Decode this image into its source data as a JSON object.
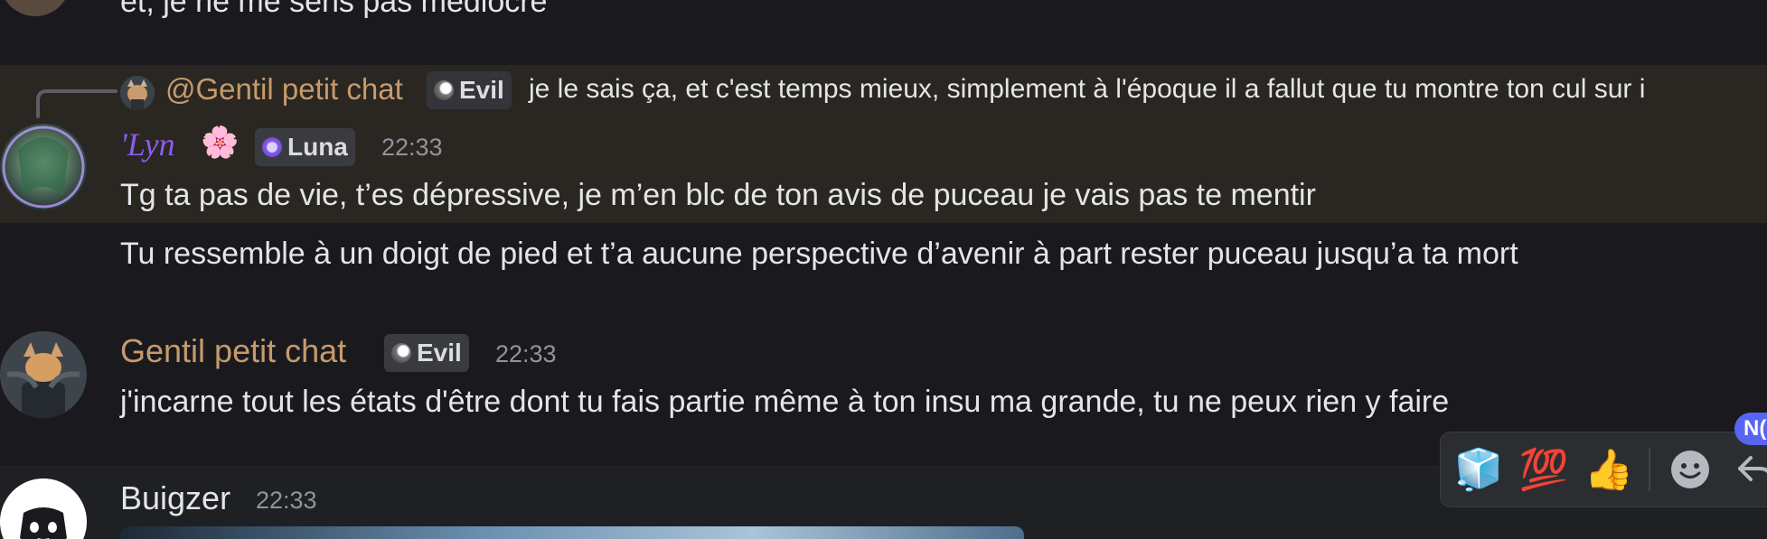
{
  "messages": {
    "top_fragment": "et, je ne me sens pas médiocre",
    "reply": {
      "mention": "@Gentil petit chat",
      "role": "Evil",
      "text": "je le sais ça, et c'est temps mieux, simplement à l'époque il a fallut que tu montre ton cul sur i"
    },
    "lyn": {
      "username": "'Lyn",
      "flower": "🌸",
      "role": "Luna",
      "time": "22:33",
      "line1": "Tg ta pas de vie, t’es dépressive, je m’en blc de ton avis de puceau je vais pas te mentir",
      "line2": "Tu ressemble à un doigt de pied et t’a aucune perspective d’avenir à part rester puceau jusqu’a ta mort"
    },
    "chat": {
      "username": "Gentil petit chat",
      "role": "Evil",
      "time": "22:33",
      "text": "j'incarne tout les états d'être dont tu fais partie même à ton insu ma grande, tu ne peux rien y faire"
    },
    "buigzer": {
      "username": "Buigzer",
      "time": "22:33"
    }
  },
  "reaction_bar": {
    "emojis": [
      "🧊",
      "💯",
      "👍"
    ],
    "new_badge": "N("
  },
  "colors": {
    "background": "#1a1a1e",
    "highlight": "#2a2722",
    "chat_name": "#c79a6b",
    "lyn_name": "#8e5cf0",
    "buigzer_name": "#e3e5e8",
    "timestamp": "#91949b",
    "badge": "#5865f2"
  }
}
